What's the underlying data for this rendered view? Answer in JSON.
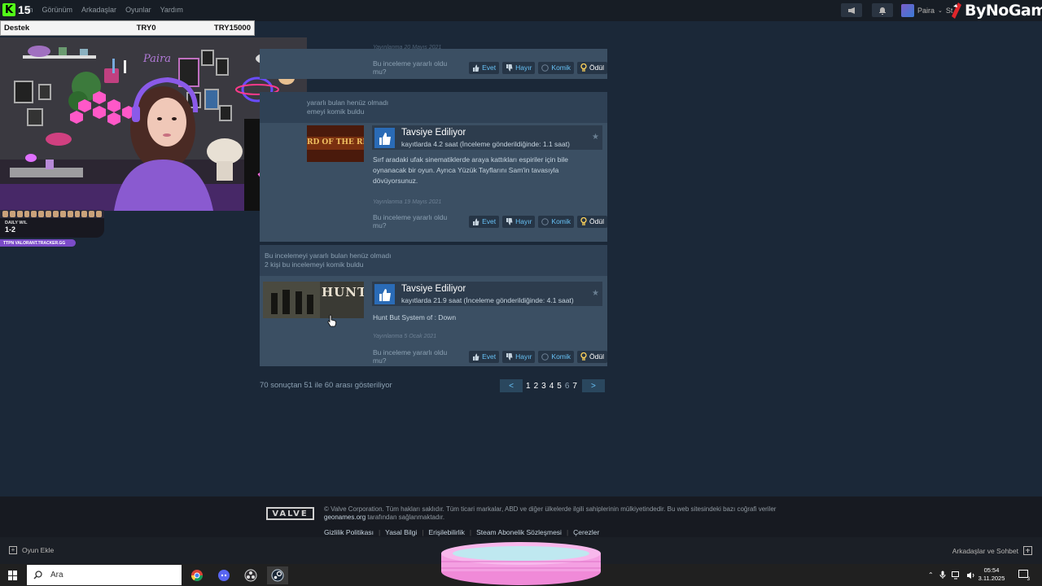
{
  "kick": {
    "viewer_count": "15"
  },
  "steam_menu": {
    "items": [
      "m",
      "Görünüm",
      "Arkadaşlar",
      "Oyunlar",
      "Yardım"
    ]
  },
  "user": {
    "name": "Paira",
    "extra": "St"
  },
  "brand": {
    "name": "ByNoGame"
  },
  "donation": {
    "label": "Destek",
    "current": "TRY0",
    "goal": "TRY15000"
  },
  "cam": {
    "name_sign": "Paira"
  },
  "stream_stats": {
    "daily_label": "DAILY W/L",
    "daily_value": "1-2",
    "tracker": "TTPN  VALORANT.TRACKER.GG"
  },
  "review_top": {
    "posted_partial": "Yayınlanma 20 Mayıs 2021",
    "helpful_q": "Bu inceleme yararlı oldu mu?",
    "yes": "Evet",
    "no": "Hayır",
    "funny": "Komik",
    "award": "Ödül"
  },
  "review_1": {
    "head1": "yararlı bulan henüz olmadı",
    "head2": "emeyi komik buldu",
    "game_art_text": "RD OF THE RINGS",
    "rec_title": "Tavsiye Ediliyor",
    "hours": "kayıtlarda 4.2 saat (İnceleme gönderildiğinde: 1.1 saat)",
    "text": "Sırf aradaki ufak sinematiklerde araya kattıkları espiriler için bile oynanacak bir oyun. Ayrıca Yüzük Tayflarını Sam'in tavasıyla dövüyorsunuz.",
    "posted": "Yayınlanma 19 Mayıs 2021",
    "helpful_q": "Bu inceleme yararlı oldu mu?",
    "yes": "Evet",
    "no": "Hayır",
    "funny": "Komik",
    "award": "Ödül"
  },
  "review_2": {
    "head1": "Bu incelemeyi yararlı bulan henüz olmadı",
    "head2": "2 kişi bu incelemeyi komik buldu",
    "game_art_text": "HUNT",
    "rec_title": "Tavsiye Ediliyor",
    "hours": "kayıtlarda 21.9 saat (İnceleme gönderildiğinde: 4.1 saat)",
    "text": "Hunt But System of : Down",
    "posted": "Yayınlanma 5 Ocak 2021",
    "helpful_q": "Bu inceleme yararlı oldu mu?",
    "yes": "Evet",
    "no": "Hayır",
    "funny": "Komik",
    "award": "Ödül"
  },
  "pagination": {
    "info": "70 sonuçtan 51 ile 60 arası gösteriliyor",
    "prev": "<",
    "next": ">",
    "pages": [
      "1",
      "2",
      "3",
      "4",
      "5",
      "6",
      "7"
    ],
    "current": "6"
  },
  "footer": {
    "logo": "VALVE",
    "copyright_a": "© Valve Corporation. Tüm hakları saklıdır. Tüm ticari markalar, ABD ve diğer ülkelerde ilgili sahiplerinin mülkiyetindedir. Bu web sitesindeki bazı coğrafi veriler ",
    "copyright_link": "geonames.org",
    "copyright_b": " tarafından sağlanmaktadır.",
    "links": [
      "Gizlilik Politikası",
      "Yasal Bilgi",
      "Erişilebilirlik",
      "Steam Abonelik Sözleşmesi",
      "Çerezler"
    ]
  },
  "steam_bottom": {
    "add_game": "Oyun Ekle",
    "friends": "Arkadaşlar ve Sohbet"
  },
  "taskbar": {
    "search_placeholder": "Ara",
    "time": "05:54",
    "date": "3.11.2025",
    "notif_count": "3"
  }
}
